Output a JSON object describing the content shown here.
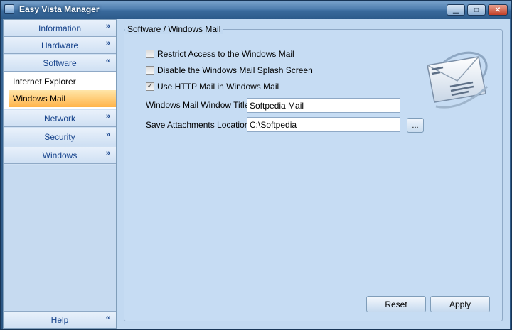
{
  "window": {
    "title": "Easy Vista Manager",
    "controls": {
      "minimize": "▁",
      "maximize": "□",
      "close": "✕"
    }
  },
  "sidebar": {
    "categories": [
      {
        "label": "Information",
        "chevron": "»",
        "expanded": false
      },
      {
        "label": "Hardware",
        "chevron": "»",
        "expanded": false
      },
      {
        "label": "Software",
        "chevron": "«",
        "expanded": true
      },
      {
        "label": "Network",
        "chevron": "»",
        "expanded": false
      },
      {
        "label": "Security",
        "chevron": "»",
        "expanded": false
      },
      {
        "label": "Windows",
        "chevron": "»",
        "expanded": false
      }
    ],
    "software_items": [
      {
        "label": "Internet Explorer",
        "selected": false
      },
      {
        "label": "Windows Mail",
        "selected": true
      }
    ],
    "help": {
      "label": "Help",
      "chevron": "«"
    }
  },
  "main": {
    "group_title": "Software / Windows Mail",
    "options": [
      {
        "label": "Restrict Access to the Windows Mail",
        "checked": false
      },
      {
        "label": "Disable the Windows Mail Splash Screen",
        "checked": false
      },
      {
        "label": "Use HTTP Mail in Windows Mail",
        "checked": true
      }
    ],
    "fields": {
      "title_label": "Windows Mail Window Title:",
      "title_value": "Softpedia Mail",
      "attach_label": "Save Attachments Location:",
      "attach_value": "C:\\Softpedia",
      "browse_label": "..."
    },
    "buttons": {
      "reset": "Reset",
      "apply": "Apply"
    }
  },
  "icons": [
    "app-icon",
    "chevron-down-icon",
    "chevron-up-icon",
    "mail-envelope-icon",
    "check-icon"
  ],
  "colors": {
    "accent": "#15428b",
    "selection": "#ffb44a",
    "panel": "#c2d9f1"
  }
}
